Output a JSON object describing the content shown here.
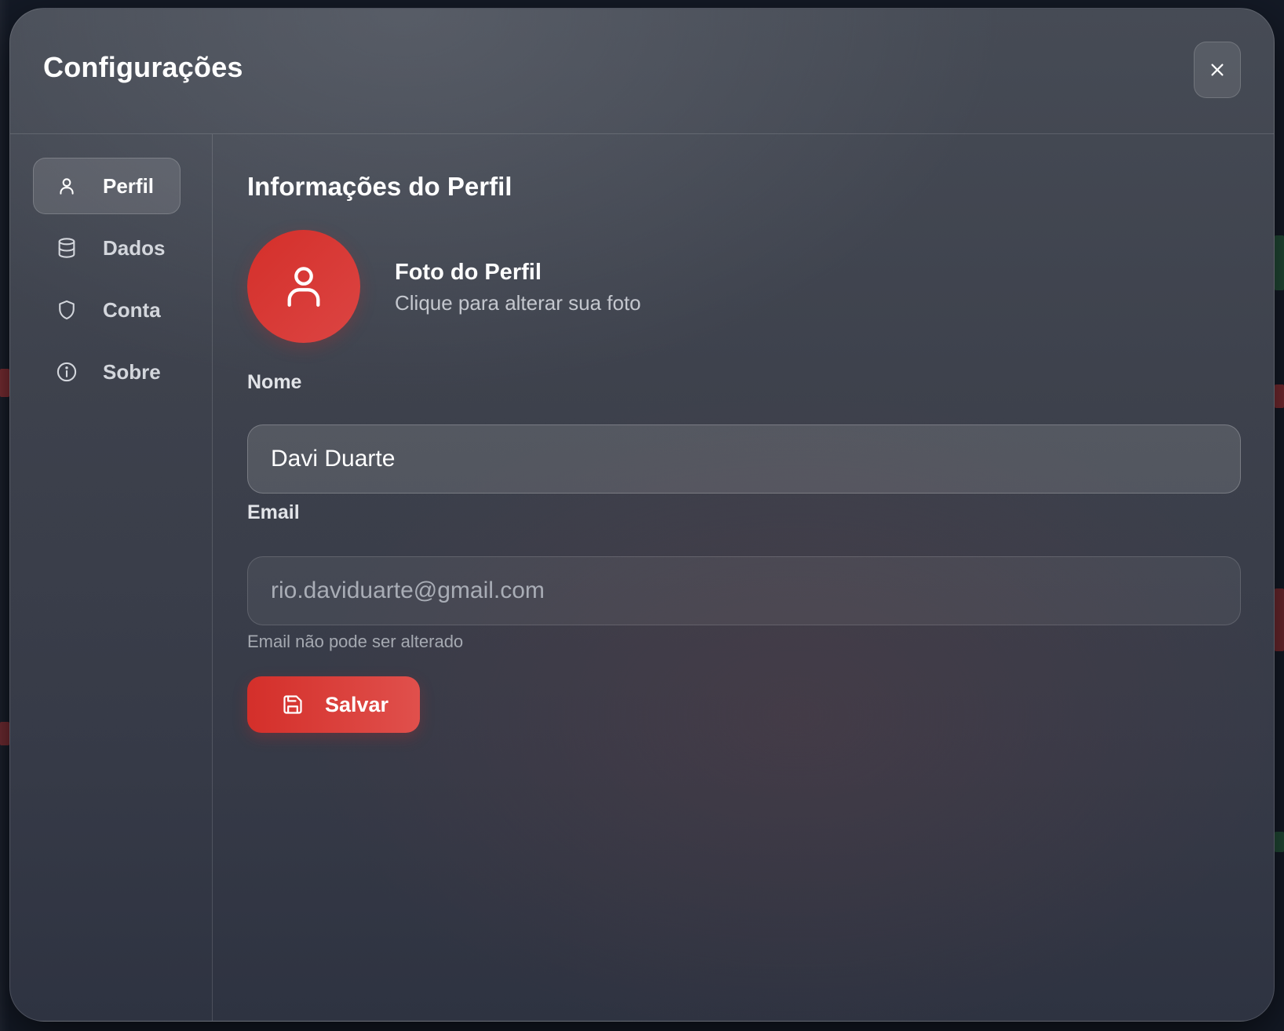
{
  "modal": {
    "title": "Configurações",
    "close_icon": "close-icon"
  },
  "sidebar": {
    "items": [
      {
        "label": "Perfil",
        "icon": "user-icon",
        "active": true
      },
      {
        "label": "Dados",
        "icon": "database-icon",
        "active": false
      },
      {
        "label": "Conta",
        "icon": "shield-icon",
        "active": false
      },
      {
        "label": "Sobre",
        "icon": "info-icon",
        "active": false
      }
    ]
  },
  "profile": {
    "section_title": "Informações do Perfil",
    "photo": {
      "title": "Foto do Perfil",
      "subtitle": "Clique para alterar sua foto",
      "icon": "user-icon"
    },
    "name": {
      "label": "Nome",
      "value": "Davi Duarte"
    },
    "email": {
      "label": "Email",
      "value": "rio.daviduarte@gmail.com",
      "hint": "Email não pode ser alterado",
      "disabled": true
    },
    "save": {
      "label": "Salvar",
      "icon": "save-icon"
    }
  },
  "colors": {
    "accent": "#d42f2a",
    "accent_light": "#e0504c",
    "modal_bg": "#3d414c",
    "text_primary": "#ffffff",
    "text_secondary": "#c4c7ce"
  }
}
